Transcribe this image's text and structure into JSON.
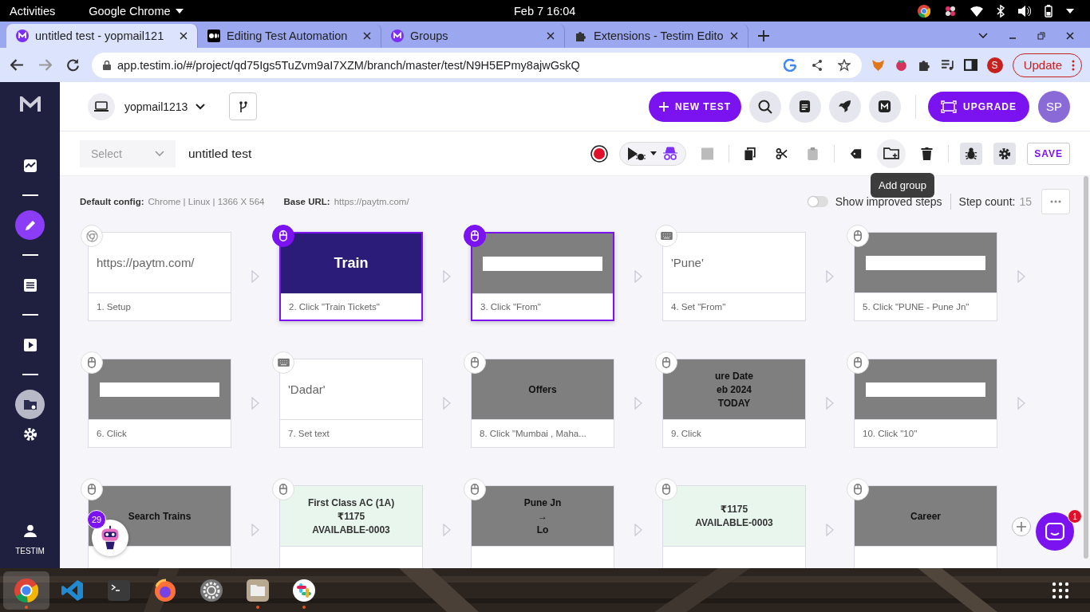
{
  "system_bar": {
    "activities": "Activities",
    "app": "Google Chrome",
    "clock": "Feb 7  16:04"
  },
  "browser": {
    "tabs": [
      {
        "title": "untitled test - yopmail121",
        "kind": "logo",
        "selected": true
      },
      {
        "title": "Editing Test Automation",
        "kind": "dots",
        "selected": false
      },
      {
        "title": "Groups",
        "kind": "logo",
        "selected": false
      },
      {
        "title": "Extensions - Testim Edito",
        "kind": "puzzle",
        "selected": false
      }
    ],
    "url": "app.testim.io/#/project/qd75Igs5TuZvm9aI7XZM/branch/master/test/N9H5EPmy8ajwGskQ",
    "profile": "S",
    "update": "Update"
  },
  "sidebar": {
    "items": [
      {
        "kind": "chart",
        "selected": false
      },
      {
        "kind": "pencil",
        "selected": true
      },
      {
        "kind": "list",
        "selected": false
      },
      {
        "kind": "play",
        "selected": false
      },
      {
        "kind": "folder",
        "selected": false
      },
      {
        "kind": "gear",
        "selected": false
      }
    ],
    "user_label": "TESTIM"
  },
  "header": {
    "project": "yopmail1213",
    "new_test": "NEW TEST",
    "upgrade": "UPGRADE",
    "avatar": "SP"
  },
  "toolbar": {
    "select_placeholder": "Select",
    "test_name": "untitled test",
    "save": "SAVE",
    "tooltip": "Add group"
  },
  "info": {
    "config_label": "Default config:",
    "config_value": "Chrome | Linux | 1366 X 564",
    "base_url_label": "Base URL:",
    "base_url": "https://paytm.com/",
    "improved_steps": {
      "label": "Show improved steps",
      "on": false
    },
    "step_count_label": "Step count:",
    "step_count": "15"
  },
  "steps": [
    {
      "label": "1. Setup",
      "kind": "setup",
      "selected": false,
      "value": "https://paytm.com/"
    },
    {
      "label": "2. Click \"Train Tickets\"",
      "kind": "click",
      "selected": true,
      "texts": [
        "Train"
      ]
    },
    {
      "label": "3. Click \"From\"",
      "kind": "click",
      "selected": true
    },
    {
      "label": "4. Set \"From\"",
      "kind": "type",
      "selected": false,
      "value": "'Pune'"
    },
    {
      "label": "5. Click \"PUNE - Pune Jn\"",
      "kind": "click",
      "selected": false
    },
    {
      "label": "6. Click",
      "kind": "click",
      "selected": false
    },
    {
      "label": "7. Set text",
      "kind": "type",
      "selected": false,
      "value": "'Dadar'"
    },
    {
      "label": "8. Click \"Mumbai , Maha...",
      "kind": "click",
      "selected": false,
      "texts": [
        "Offers"
      ]
    },
    {
      "label": "9. Click",
      "kind": "click",
      "selected": false,
      "texts": [
        "ure Date",
        "eb 2024",
        "TODAY"
      ]
    },
    {
      "label": "10. Click \"10\"",
      "kind": "click",
      "selected": false
    },
    {
      "kind": "click",
      "selected": false,
      "texts": [
        "Search Trains"
      ]
    },
    {
      "kind": "click",
      "selected": false,
      "texts": [
        "First Class AC (1A)",
        "₹1175",
        "AVAILABLE-0003"
      ]
    },
    {
      "kind": "click",
      "selected": false,
      "texts": [
        "Pune Jn",
        "→",
        "Lo"
      ]
    },
    {
      "kind": "click",
      "selected": false,
      "texts": [
        "₹1175",
        "AVAILABLE-0003"
      ]
    },
    {
      "kind": "click",
      "selected": false,
      "texts": [
        "Career"
      ]
    }
  ],
  "assistant_badge": "29",
  "chat_badge": "1"
}
